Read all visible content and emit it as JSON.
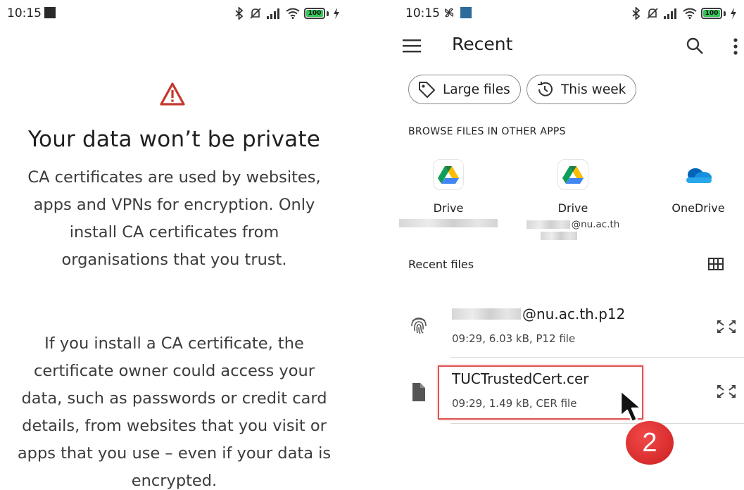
{
  "left_screen": {
    "status_time": "10:15",
    "battery_level": "100",
    "title": "Your data won’t be private",
    "paragraph_1": "CA certificates are used by websites, apps and VPNs for encryption. Only install CA certificates from organisations that you trust.",
    "paragraph_2": "If you install a CA certificate, the certificate owner could access your data, such as passwords or credit card details, from websites that you visit or apps that you use – even if your data is encrypted."
  },
  "right_screen": {
    "status_time": "10:15",
    "battery_level": "100",
    "app_title": "Recent",
    "chips": [
      {
        "label": "Large files",
        "icon": "tag-icon"
      },
      {
        "label": "This week",
        "icon": "history-icon"
      }
    ],
    "browse_heading": "BROWSE FILES IN OTHER APPS",
    "apps": [
      {
        "name": "Drive",
        "account_suffix": "",
        "icon": "google-drive-icon"
      },
      {
        "name": "Drive",
        "account_suffix": "@nu.ac.th",
        "icon": "google-drive-icon"
      },
      {
        "name": "OneDrive",
        "account_suffix": "",
        "icon": "onedrive-icon"
      }
    ],
    "recent_heading": "Recent files",
    "files": [
      {
        "name_suffix": "@nu.ac.th.p12",
        "meta": "09:29, 6.03 kB, P12 file",
        "icon": "fingerprint-icon"
      },
      {
        "name": "TUCTrustedCert.cer",
        "meta": "09:29, 1.49 kB, CER file",
        "icon": "document-icon"
      }
    ],
    "step_number": "2"
  },
  "colors": {
    "warning_red": "#c5372c",
    "highlight_red": "#e05353",
    "badge_red": "#d82c2c",
    "battery_green": "#34c759",
    "accent_blue": "#1a73e8"
  }
}
